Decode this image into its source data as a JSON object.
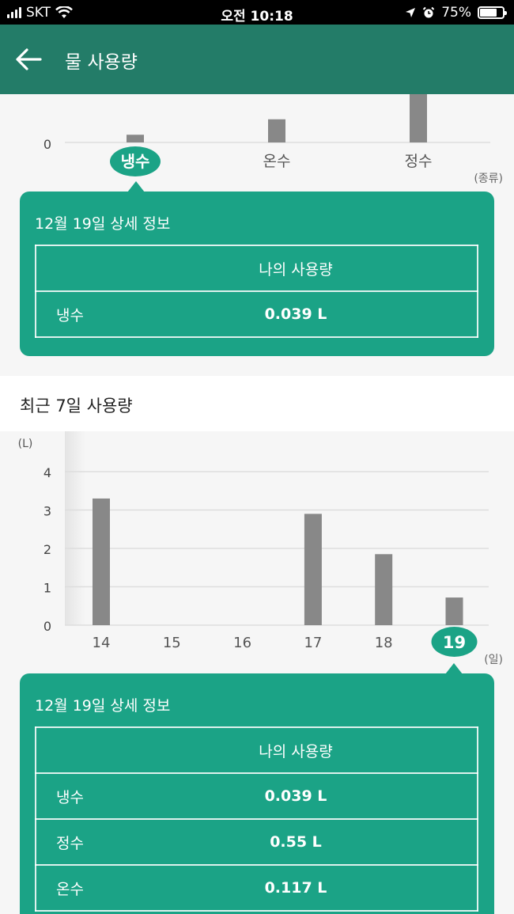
{
  "status_bar": {
    "carrier": "SKT",
    "time": "오전 10:18",
    "battery": "75%",
    "battery_level": 0.75
  },
  "header": {
    "title": "물 사용량"
  },
  "type_chart": {
    "chart_data": {
      "type": "bar",
      "categories": [
        "냉수",
        "온수",
        "정수"
      ],
      "values": [
        0.039,
        0.117,
        0.55
      ],
      "y_ticks": [
        "0"
      ],
      "ylim": [
        0,
        0.22
      ],
      "selected": "냉수",
      "unit_label": "(종류)"
    }
  },
  "detail_card_1": {
    "title": "12월 19일 상세 정보",
    "column_header": "나의 사용량",
    "rows": [
      {
        "label": "냉수",
        "value": "0.039 L"
      }
    ]
  },
  "recent_section": {
    "title": "최근 7일 사용량"
  },
  "daily_chart": {
    "chart_data": {
      "type": "bar",
      "categories": [
        "14",
        "15",
        "16",
        "17",
        "18",
        "19"
      ],
      "values": [
        3.3,
        0,
        0,
        2.9,
        1.85,
        0.72
      ],
      "ylabel": "(L)",
      "xlabel": "(일)",
      "y_ticks": [
        "0",
        "1",
        "2",
        "3",
        "4"
      ],
      "ylim": [
        0,
        4
      ],
      "selected": "19"
    }
  },
  "detail_card_2": {
    "title": "12월 19일 상세 정보",
    "column_header": "나의 사용량",
    "rows": [
      {
        "label": "냉수",
        "value": "0.039 L"
      },
      {
        "label": "정수",
        "value": "0.55 L"
      },
      {
        "label": "온수",
        "value": "0.117 L"
      }
    ]
  },
  "colors": {
    "header": "#237c68",
    "accent": "#1ba386",
    "bar": "#888888"
  }
}
